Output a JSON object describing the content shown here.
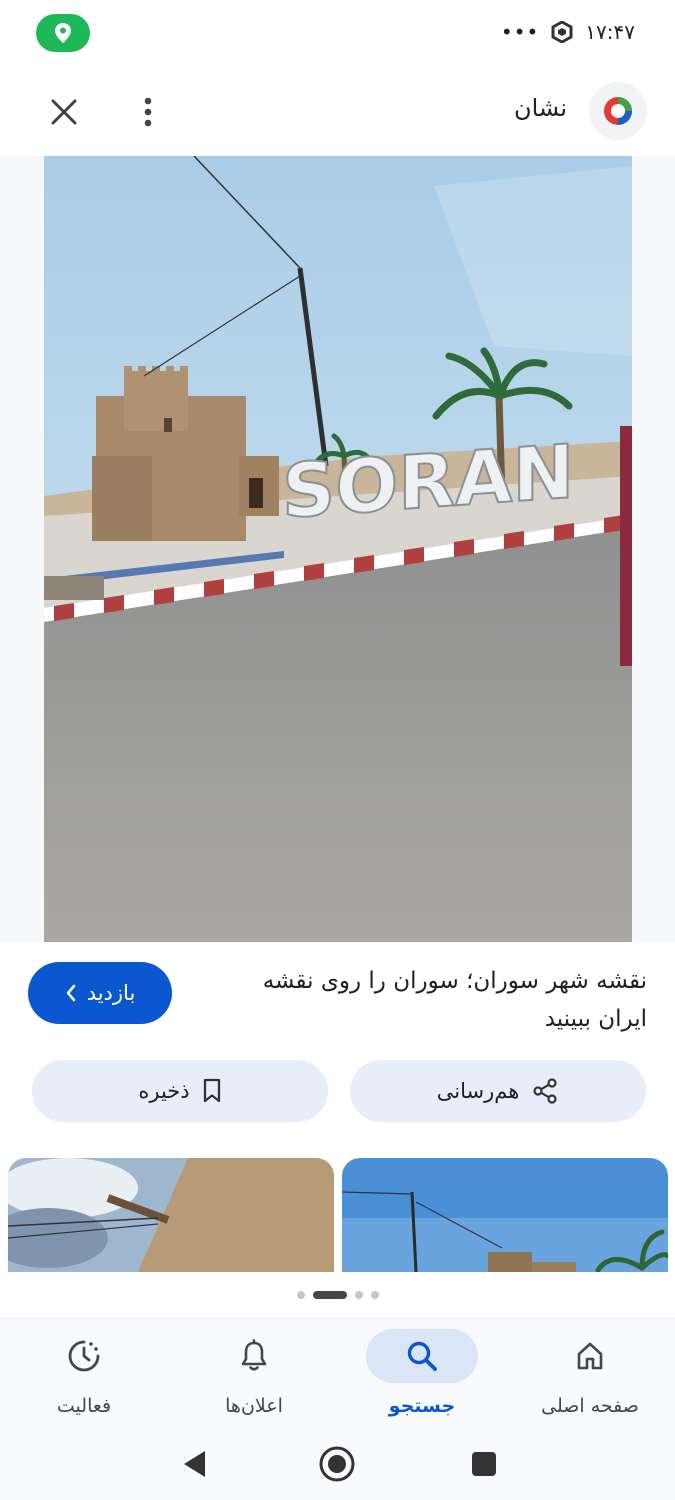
{
  "status_bar": {
    "time": "۱۷:۴۷",
    "more_indicator": "•••",
    "location_icon": "location-pin-icon",
    "location_color": "#1eb858"
  },
  "header": {
    "title": "نشان",
    "brand_icon": "neshan-logo-icon",
    "more_icon": "more-vertical-icon",
    "close_icon": "close-icon"
  },
  "main_image": {
    "sign_text": "SORAN"
  },
  "info": {
    "title": "نقشه شهر سوران؛ سوران را روی نقشه ایران ببینید",
    "visit_label": "بازدید",
    "visit_icon": "chevron-left-icon",
    "accent": "#0b57d0"
  },
  "actions": {
    "share_label": "هم‌رسانی",
    "share_icon": "share-icon",
    "save_label": "ذخیره",
    "save_icon": "bookmark-icon"
  },
  "carousel": {
    "page_count": 4,
    "active_index": 1
  },
  "bottom_nav": {
    "items": [
      {
        "label": "صفحه اصلی",
        "icon": "home-icon"
      },
      {
        "label": "جستجو",
        "icon": "search-icon",
        "active": true
      },
      {
        "label": "اعلان‌ها",
        "icon": "bell-icon"
      },
      {
        "label": "فعالیت",
        "icon": "activity-icon"
      }
    ]
  }
}
